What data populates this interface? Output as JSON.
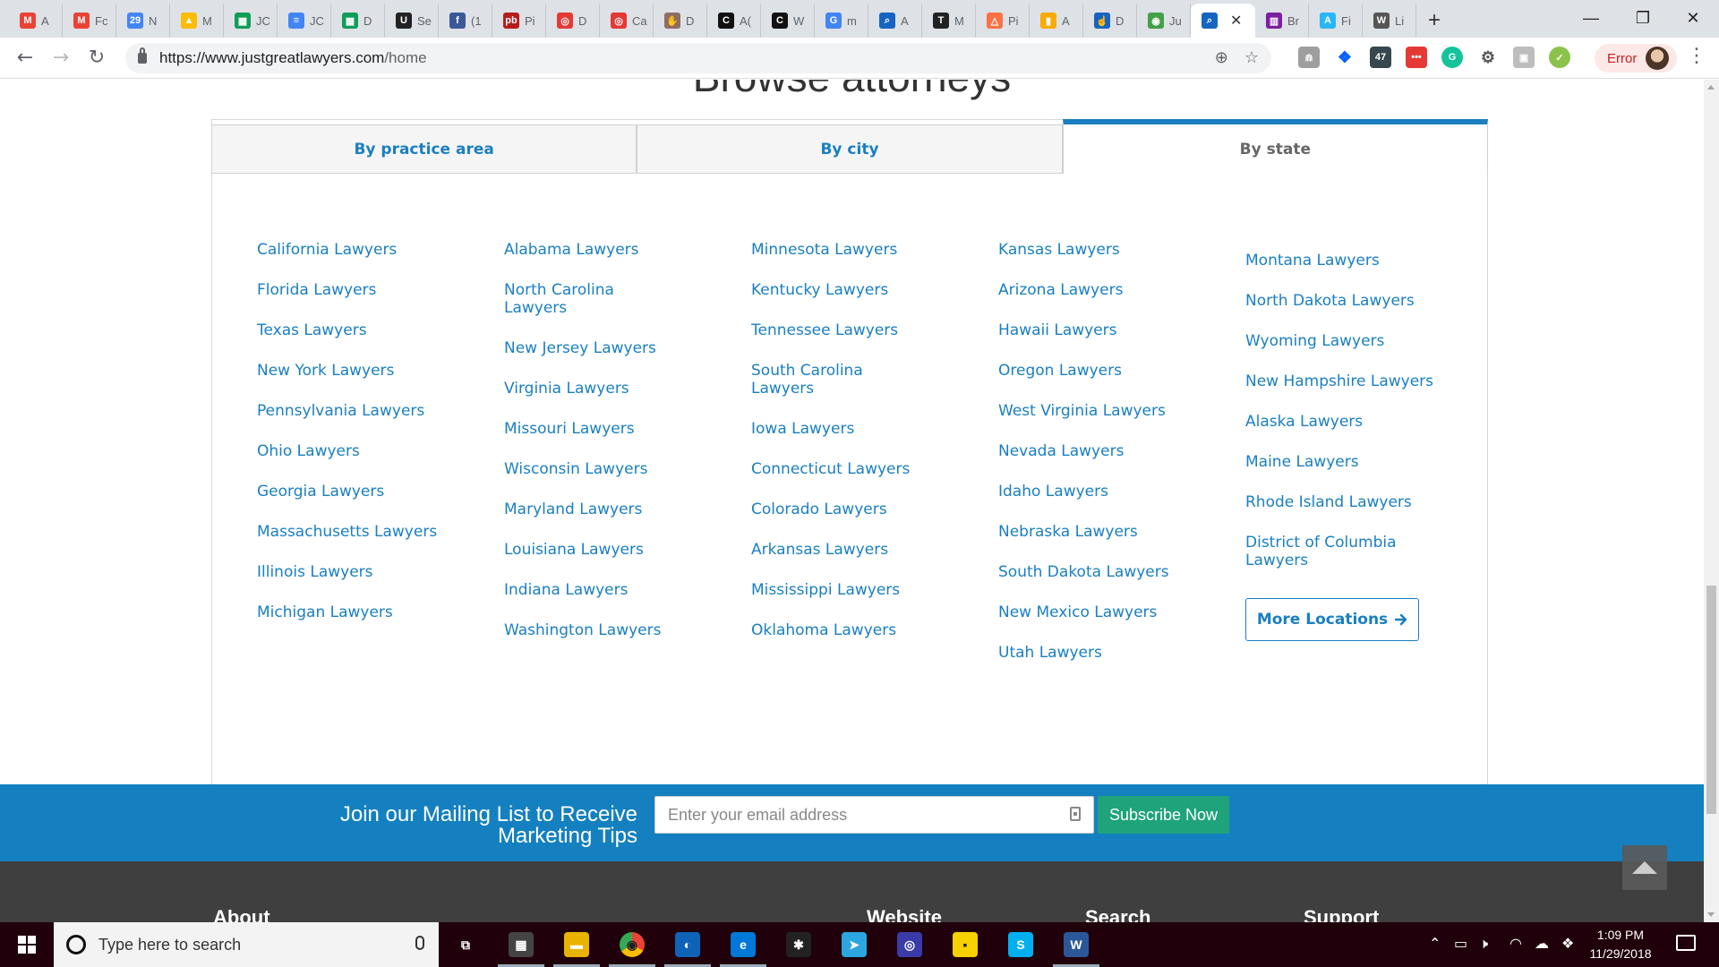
{
  "browser": {
    "tabs": [
      {
        "icon": "gmail-icon",
        "label": "A",
        "color": "#ea4335",
        "glyph": "M"
      },
      {
        "icon": "gmail-icon",
        "label": "Fc",
        "color": "#ea4335",
        "glyph": "M"
      },
      {
        "icon": "calendar-icon",
        "label": "N",
        "color": "#4285f4",
        "glyph": "29"
      },
      {
        "icon": "drive-icon",
        "label": "M",
        "color": "#fbbc04",
        "glyph": "▲"
      },
      {
        "icon": "sheets-icon",
        "label": "JC",
        "color": "#0f9d58",
        "glyph": "▦"
      },
      {
        "icon": "docs-icon",
        "label": "JC",
        "color": "#4285f4",
        "glyph": "≡"
      },
      {
        "icon": "sheets-icon",
        "label": "D",
        "color": "#0f9d58",
        "glyph": "▦"
      },
      {
        "icon": "u-icon",
        "label": "Se",
        "color": "#222222",
        "glyph": "U"
      },
      {
        "icon": "facebook-icon",
        "label": "(1",
        "color": "#3b5998",
        "glyph": "f"
      },
      {
        "icon": "pitchbook-icon",
        "label": "Pi",
        "color": "#b71c1c",
        "glyph": "pb"
      },
      {
        "icon": "target-icon",
        "label": "D",
        "color": "#e53935",
        "glyph": "◎"
      },
      {
        "icon": "target-icon",
        "label": "Ca",
        "color": "#e53935",
        "glyph": "◎"
      },
      {
        "icon": "hand-icon",
        "label": "D",
        "color": "#8d6e63",
        "glyph": "✋"
      },
      {
        "icon": "c-icon",
        "label": "A(",
        "color": "#111111",
        "glyph": "C"
      },
      {
        "icon": "c-icon",
        "label": "W",
        "color": "#111111",
        "glyph": "C"
      },
      {
        "icon": "google-icon",
        "label": "m",
        "color": "#4285f4",
        "glyph": "G"
      },
      {
        "icon": "magnifier-icon",
        "label": "A",
        "color": "#1565c0",
        "glyph": "⌕"
      },
      {
        "icon": "nytimes-icon",
        "label": "M",
        "color": "#222222",
        "glyph": "T"
      },
      {
        "icon": "triangle-icon",
        "label": "Pi",
        "color": "#ff7043",
        "glyph": "△"
      },
      {
        "icon": "analytics-icon",
        "label": "A",
        "color": "#f9ab00",
        "glyph": "▮"
      },
      {
        "icon": "pointer-icon",
        "label": "D",
        "color": "#1565c0",
        "glyph": "☝"
      },
      {
        "icon": "globe-icon",
        "label": "Ju",
        "color": "#43a047",
        "glyph": "◉"
      },
      {
        "icon": "magnifier-icon",
        "label": "",
        "color": "#1565c0",
        "glyph": "⌕"
      },
      {
        "icon": "trello-icon",
        "label": "Br",
        "color": "#7b1fa2",
        "glyph": "▥"
      },
      {
        "icon": "a-icon",
        "label": "Fi",
        "color": "#29b6f6",
        "glyph": "A"
      },
      {
        "icon": "wikipedia-icon",
        "label": "Li",
        "color": "#555555",
        "glyph": "W"
      }
    ],
    "active_tab_index": 22,
    "url_host": "https://www.justgreatlawyers.com",
    "url_path": "/home",
    "error_label": "Error"
  },
  "page": {
    "heading": "Browse attorneys",
    "tabs": [
      "By practice area",
      "By city",
      "By state"
    ],
    "active_tab": "By state",
    "columns": [
      [
        "California Lawyers",
        "Florida Lawyers",
        "Texas Lawyers",
        "New York Lawyers",
        "Pennsylvania Lawyers",
        "Ohio Lawyers",
        "Georgia Lawyers",
        "Massachusetts Lawyers",
        "Illinois Lawyers",
        "Michigan Lawyers"
      ],
      [
        "Alabama Lawyers",
        "North Carolina Lawyers",
        "New Jersey Lawyers",
        "Virginia Lawyers",
        "Missouri Lawyers",
        "Wisconsin Lawyers",
        "Maryland Lawyers",
        "Louisiana Lawyers",
        "Indiana Lawyers",
        "Washington Lawyers"
      ],
      [
        "Minnesota Lawyers",
        "Kentucky Lawyers",
        "Tennessee Lawyers",
        "South Carolina Lawyers",
        "Iowa Lawyers",
        "Connecticut Lawyers",
        "Colorado Lawyers",
        "Arkansas Lawyers",
        "Mississippi Lawyers",
        "Oklahoma Lawyers"
      ],
      [
        "Kansas Lawyers",
        "Arizona Lawyers",
        "Hawaii Lawyers",
        "Oregon Lawyers",
        "West Virginia Lawyers",
        "Nevada Lawyers",
        "Idaho Lawyers",
        "Nebraska Lawyers",
        "South Dakota Lawyers",
        "New Mexico Lawyers",
        "Utah Lawyers"
      ],
      [
        "Montana Lawyers",
        "North Dakota Lawyers",
        "Wyoming Lawyers",
        "New Hampshire Lawyers",
        "Alaska Lawyers",
        "Maine Lawyers",
        "Rhode Island Lawyers",
        "District of Columbia Lawyers"
      ]
    ],
    "more_locations_label": "More Locations",
    "mailing_text": "Join our Mailing List to Receive Marketing Tips",
    "email_placeholder": "Enter your email address",
    "subscribe_label": "Subscribe Now",
    "footer_headings": [
      "About",
      "Website",
      "Search",
      "Support"
    ],
    "link_color": "#1a7fc1",
    "mailing_bg": "#1480bf"
  },
  "taskbar": {
    "search_placeholder": "Type here to search",
    "apps": [
      "task-view-icon",
      "calculator-icon",
      "file-explorer-icon",
      "chrome-icon",
      "outlook-icon",
      "edge-icon",
      "slack-icon",
      "telegram-icon",
      "gear-app-icon",
      "sticky-notes-icon",
      "skype-icon",
      "word-icon"
    ],
    "time": "1:09 PM",
    "date": "11/29/2018"
  }
}
